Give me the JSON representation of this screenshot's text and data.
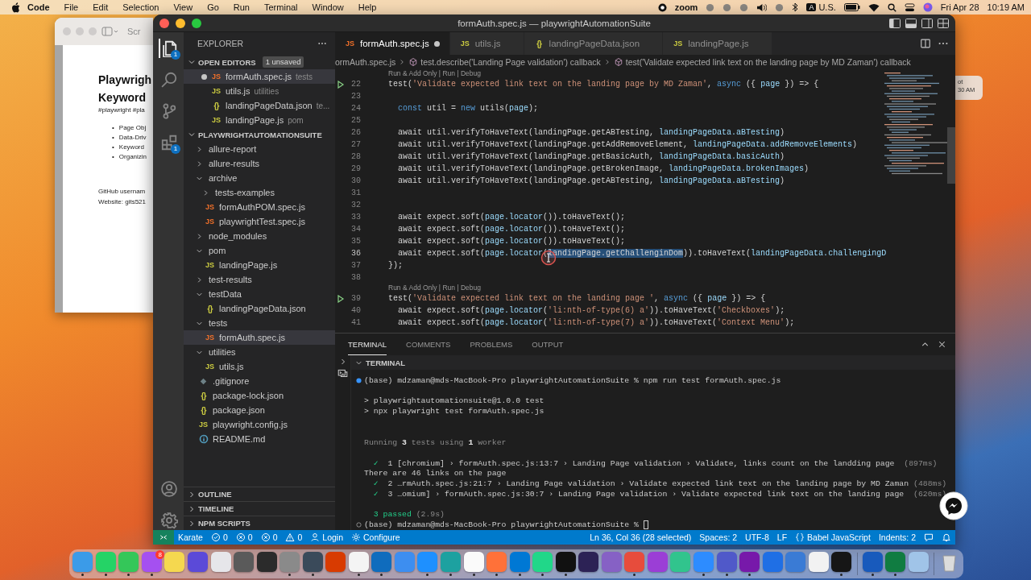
{
  "menubar": {
    "app": "Code",
    "menus": [
      "File",
      "Edit",
      "Selection",
      "View",
      "Go",
      "Run",
      "Terminal",
      "Window",
      "Help"
    ],
    "status_items": [
      {
        "kind": "record"
      },
      {
        "kind": "label",
        "text": "zoom"
      },
      {
        "kind": "dot"
      },
      {
        "kind": "dot"
      },
      {
        "kind": "dot"
      },
      {
        "kind": "speaker"
      },
      {
        "kind": "dot"
      },
      {
        "kind": "bluetooth"
      },
      {
        "kind": "input",
        "badge": "A",
        "text": "U.S."
      },
      {
        "kind": "battery"
      },
      {
        "kind": "wifi"
      },
      {
        "kind": "search"
      },
      {
        "kind": "control"
      },
      {
        "kind": "siri"
      }
    ],
    "date": "Fri Apr 28",
    "time": "10:19 AM"
  },
  "back_window": {
    "toolbar_text": "Scr",
    "heading_lines": [
      "Playwrigh",
      "Keyword"
    ],
    "tags": "#playwright #pla",
    "bullets": [
      {
        "marker": "•",
        "text": "Page Obj"
      },
      {
        "marker": "•",
        "text": "Data-Driv"
      },
      {
        "marker": "•",
        "text": "Keyword"
      },
      {
        "marker": "•",
        "text": "Organizin"
      }
    ],
    "footer_lines": [
      "GitHub usernam",
      "Website: gits521"
    ]
  },
  "notification_fragment": {
    "lines": [
      "ot",
      "30 AM"
    ]
  },
  "window": {
    "title": "formAuth.spec.js — playwrightAutomationSuite"
  },
  "activity_bar": [
    {
      "kind": "files",
      "badge": "1",
      "selected": true
    },
    {
      "kind": "search",
      "selected": false
    },
    {
      "kind": "source-control",
      "selected": false
    },
    {
      "kind": "extensions",
      "badge": "1",
      "selected": false
    },
    {
      "kind": "account",
      "selected": false
    },
    {
      "kind": "settings",
      "selected": false
    }
  ],
  "sidebar": {
    "title": "EXPLORER",
    "open_editors": {
      "title": "OPEN EDITORS",
      "badge": "1 unsaved",
      "expanded": true,
      "items": [
        {
          "kind": "js",
          "icon": "JS",
          "color": "#f0702a",
          "name": "formAuth.spec.js",
          "description": "tests",
          "dirty": true,
          "selected": true
        },
        {
          "kind": "js",
          "icon": "JS",
          "color": "#cbcb41",
          "name": "utils.js",
          "description": "utilities",
          "dirty": false,
          "selected": false
        },
        {
          "kind": "json",
          "icon": "{}",
          "color": "#cbcb41",
          "name": "landingPageData.json",
          "description": "te...",
          "dirty": false,
          "selected": false
        },
        {
          "kind": "js",
          "icon": "JS",
          "color": "#cbcb41",
          "name": "landingPage.js",
          "description": "pom",
          "dirty": false,
          "selected": false
        }
      ]
    },
    "project": {
      "title": "PLAYWRIGHTAUTOMATIONSUITE",
      "expanded": true,
      "tree": [
        {
          "kind": "folder",
          "name": "allure-report",
          "expanded": false,
          "selected": false
        },
        {
          "kind": "folder",
          "name": "allure-results",
          "expanded": false,
          "selected": false
        },
        {
          "kind": "folder",
          "name": "archive",
          "expanded": true,
          "selected": false,
          "children": [
            {
              "kind": "folder",
              "name": "tests-examples",
              "expanded": false,
              "selected": false
            },
            {
              "kind": "js",
              "icon": "JS",
              "color": "#f0702a",
              "name": "formAuthPOM.spec.js",
              "selected": false
            },
            {
              "kind": "js",
              "icon": "JS",
              "color": "#f0702a",
              "name": "playwrightTest.spec.js",
              "selected": false
            }
          ]
        },
        {
          "kind": "folder",
          "name": "node_modules",
          "expanded": false,
          "selected": false
        },
        {
          "kind": "folder",
          "name": "pom",
          "expanded": true,
          "selected": false,
          "children": [
            {
              "kind": "js",
              "icon": "JS",
              "color": "#cbcb41",
              "name": "landingPage.js",
              "selected": false
            }
          ]
        },
        {
          "kind": "folder",
          "name": "test-results",
          "expanded": false,
          "selected": false
        },
        {
          "kind": "folder",
          "name": "testData",
          "expanded": true,
          "selected": false,
          "children": [
            {
              "kind": "json",
              "icon": "{}",
              "color": "#cbcb41",
              "name": "landingPageData.json",
              "selected": false
            }
          ]
        },
        {
          "kind": "folder",
          "name": "tests",
          "expanded": true,
          "selected": false,
          "children": [
            {
              "kind": "js",
              "icon": "JS",
              "color": "#f0702a",
              "name": "formAuth.spec.js",
              "selected": true
            }
          ]
        },
        {
          "kind": "folder",
          "name": "utilities",
          "expanded": true,
          "selected": false,
          "children": [
            {
              "kind": "js",
              "icon": "JS",
              "color": "#cbcb41",
              "name": "utils.js",
              "selected": false
            }
          ]
        },
        {
          "kind": "git",
          "color": "#6d8086",
          "name": ".gitignore",
          "selected": false
        },
        {
          "kind": "json",
          "icon": "{}",
          "color": "#cbcb41",
          "name": "package-lock.json",
          "selected": false
        },
        {
          "kind": "json",
          "icon": "{}",
          "color": "#cbcb41",
          "name": "package.json",
          "selected": false
        },
        {
          "kind": "js",
          "icon": "JS",
          "color": "#cbcb41",
          "name": "playwright.config.js",
          "selected": false
        },
        {
          "kind": "info",
          "color": "#519aba",
          "name": "README.md",
          "selected": false
        }
      ]
    },
    "sections": [
      {
        "title": "OUTLINE",
        "expanded": false
      },
      {
        "title": "TIMELINE",
        "expanded": false
      },
      {
        "title": "NPM SCRIPTS",
        "expanded": false
      }
    ]
  },
  "editor": {
    "tabs": [
      {
        "kind": "js",
        "icon": "JS",
        "color": "#f0702a",
        "label": "formAuth.spec.js",
        "dirty": true,
        "selected": true
      },
      {
        "kind": "js",
        "icon": "JS",
        "color": "#cbcb41",
        "label": "utils.js",
        "dirty": false,
        "selected": false
      },
      {
        "kind": "json",
        "icon": "{}",
        "color": "#cbcb41",
        "label": "landingPageData.json",
        "dirty": false,
        "selected": false
      },
      {
        "kind": "js",
        "icon": "JS",
        "color": "#cbcb41",
        "label": "landingPage.js",
        "dirty": false,
        "selected": false
      }
    ],
    "breadcrumb": [
      {
        "kind": "file",
        "text": "ormAuth.spec.js"
      },
      {
        "kind": "scope",
        "text": "test.describe('Landing Page validation') callback"
      },
      {
        "kind": "scope",
        "text": "test('Validate expected link text on the landing page by MD Zaman') callback"
      }
    ],
    "lines": [
      {
        "kind": "codelens",
        "text": "Run & Add Only | Run | Debug"
      },
      {
        "kind": "test",
        "number": "22",
        "tokens": [
          {
            "text": "test(",
            "kind": "plain"
          },
          {
            "text": "'Validate expected link text on the landing page by MD Zaman'",
            "kind": "string"
          },
          {
            "text": ", ",
            "kind": "plain"
          },
          {
            "text": "async",
            "kind": "keyword"
          },
          {
            "text": " ({ ",
            "kind": "plain"
          },
          {
            "text": "page",
            "kind": "variable"
          },
          {
            "text": " }) => {",
            "kind": "plain"
          }
        ]
      },
      {
        "kind": "code",
        "number": "23"
      },
      {
        "kind": "code",
        "number": "24",
        "tokens": [
          {
            "text": "  const",
            "kind": "keyword"
          },
          {
            "text": " util = ",
            "kind": "plain"
          },
          {
            "text": "new",
            "kind": "keyword"
          },
          {
            "text": " utils(",
            "kind": "plain"
          },
          {
            "text": "page",
            "kind": "variable"
          },
          {
            "text": ");",
            "kind": "plain"
          }
        ]
      },
      {
        "kind": "code",
        "number": "25"
      },
      {
        "kind": "code",
        "number": "26",
        "tokens": [
          {
            "text": "  await util.verifyToHaveText(landingPage.getABTesting, ",
            "kind": "plain"
          },
          {
            "text": "landingPageData.aBTesting",
            "kind": "variable"
          },
          {
            "text": ")",
            "kind": "plain"
          }
        ]
      },
      {
        "kind": "code",
        "number": "27",
        "tokens": [
          {
            "text": "  await util.verifyToHaveText(landingPage.getAddRemoveElement, ",
            "kind": "plain"
          },
          {
            "text": "landingPageData.addRemoveElements",
            "kind": "variable"
          },
          {
            "text": ")",
            "kind": "plain"
          }
        ]
      },
      {
        "kind": "code",
        "number": "28",
        "tokens": [
          {
            "text": "  await util.verifyToHaveText(landingPage.getBasicAuth, ",
            "kind": "plain"
          },
          {
            "text": "landingPageData.basicAuth",
            "kind": "variable"
          },
          {
            "text": ")",
            "kind": "plain"
          }
        ]
      },
      {
        "kind": "code",
        "number": "29",
        "tokens": [
          {
            "text": "  await util.verifyToHaveText(landingPage.getBrokenImage, ",
            "kind": "plain"
          },
          {
            "text": "landingPageData.brokenImages",
            "kind": "variable"
          },
          {
            "text": ")",
            "kind": "plain"
          }
        ]
      },
      {
        "kind": "code",
        "number": "30",
        "tokens": [
          {
            "text": "  await util.verifyToHaveText(landingPage.getABTesting, ",
            "kind": "plain"
          },
          {
            "text": "landingPageData.aBTesting",
            "kind": "variable"
          },
          {
            "text": ")",
            "kind": "plain"
          }
        ]
      },
      {
        "kind": "code",
        "number": "31"
      },
      {
        "kind": "code",
        "number": "32"
      },
      {
        "kind": "code",
        "number": "33",
        "tokens": [
          {
            "text": "  await expect.soft(",
            "kind": "plain"
          },
          {
            "text": "page.locator",
            "kind": "variable"
          },
          {
            "text": "()).toHaveText();",
            "kind": "plain"
          }
        ]
      },
      {
        "kind": "code",
        "number": "34",
        "tokens": [
          {
            "text": "  await expect.soft(",
            "kind": "plain"
          },
          {
            "text": "page.locator",
            "kind": "variable"
          },
          {
            "text": "()).toHaveText();",
            "kind": "plain"
          }
        ]
      },
      {
        "kind": "code",
        "number": "35",
        "tokens": [
          {
            "text": "  await expect.soft(",
            "kind": "plain"
          },
          {
            "text": "page.locator",
            "kind": "variable"
          },
          {
            "text": "()).toHaveText();",
            "kind": "plain"
          }
        ]
      },
      {
        "kind": "code",
        "number": "36",
        "tokens": [
          {
            "text": "  await expect.soft(",
            "kind": "plain"
          },
          {
            "text": "page.locator",
            "kind": "variable"
          },
          {
            "text": "(",
            "kind": "plain"
          },
          {
            "text": "landingPage.getChallenginDom",
            "kind": "selection"
          },
          {
            "text": ")).toHaveText(",
            "kind": "plain"
          },
          {
            "text": "landingPageData.challengingD",
            "kind": "variable"
          }
        ]
      },
      {
        "kind": "code",
        "number": "37",
        "tokens": [
          {
            "text": "});",
            "kind": "plain"
          }
        ]
      },
      {
        "kind": "code",
        "number": "38"
      },
      {
        "kind": "codelens",
        "text": "Run & Add Only | Run | Debug"
      },
      {
        "kind": "test",
        "number": "39",
        "tokens": [
          {
            "text": "test(",
            "kind": "plain"
          },
          {
            "text": "'Validate expected link text on the landing page '",
            "kind": "string"
          },
          {
            "text": ", ",
            "kind": "plain"
          },
          {
            "text": "async",
            "kind": "keyword"
          },
          {
            "text": " ({ ",
            "kind": "plain"
          },
          {
            "text": "page",
            "kind": "variable"
          },
          {
            "text": " }) => {",
            "kind": "plain"
          }
        ]
      },
      {
        "kind": "code",
        "number": "40",
        "tokens": [
          {
            "text": "  await expect.soft(",
            "kind": "plain"
          },
          {
            "text": "page.locator",
            "kind": "variable"
          },
          {
            "text": "(",
            "kind": "plain"
          },
          {
            "text": "'li:nth-of-type(6) a'",
            "kind": "string"
          },
          {
            "text": ")).toHaveText(",
            "kind": "plain"
          },
          {
            "text": "'Checkboxes'",
            "kind": "string"
          },
          {
            "text": ");",
            "kind": "plain"
          }
        ]
      },
      {
        "kind": "code",
        "number": "41",
        "tokens": [
          {
            "text": "  await expect.soft(",
            "kind": "plain"
          },
          {
            "text": "page.locator",
            "kind": "variable"
          },
          {
            "text": "(",
            "kind": "plain"
          },
          {
            "text": "'li:nth-of-type(7) a'",
            "kind": "string"
          },
          {
            "text": ")).toHaveText(",
            "kind": "plain"
          },
          {
            "text": "'Context Menu'",
            "kind": "string"
          },
          {
            "text": ");",
            "kind": "plain"
          }
        ]
      }
    ]
  },
  "panel": {
    "tabs": [
      {
        "label": "TERMINAL",
        "selected": true
      },
      {
        "label": "COMMENTS",
        "selected": false
      },
      {
        "label": "PROBLEMS",
        "selected": false
      },
      {
        "label": "OUTPUT",
        "selected": false
      }
    ],
    "section_title": "TERMINAL",
    "lines": [
      {
        "kind": "command",
        "segments": [
          {
            "text": "(base) mdzaman@mds-MacBook-Pro playwrightAutomationSuite % npm run test formAuth.spec.js",
            "kind": "plain"
          }
        ]
      },
      {
        "kind": "blank"
      },
      {
        "kind": "output",
        "segments": [
          {
            "text": "> playwrightautomationsuite@1.0.0 test",
            "kind": "plain"
          }
        ]
      },
      {
        "kind": "output",
        "segments": [
          {
            "text": "> npx playwright test formAuth.spec.js",
            "kind": "plain"
          }
        ]
      },
      {
        "kind": "blank"
      },
      {
        "kind": "blank"
      },
      {
        "kind": "output",
        "segments": [
          {
            "text": "Running ",
            "kind": "dim"
          },
          {
            "text": "3",
            "kind": "bold"
          },
          {
            "text": " tests using ",
            "kind": "dim"
          },
          {
            "text": "1",
            "kind": "bold"
          },
          {
            "text": " worker",
            "kind": "dim"
          }
        ]
      },
      {
        "kind": "blank"
      },
      {
        "kind": "output",
        "segments": [
          {
            "text": "  ✓",
            "kind": "green"
          },
          {
            "text": "  1 [chromium] › formAuth.spec.js:13:7 › Landing Page validation › Validate, links count on the landding page  ",
            "kind": "plain"
          },
          {
            "text": "(897ms)",
            "kind": "dim"
          }
        ]
      },
      {
        "kind": "output",
        "segments": [
          {
            "text": "There are 46 links on the page",
            "kind": "plain"
          }
        ]
      },
      {
        "kind": "output",
        "segments": [
          {
            "text": "  ✓",
            "kind": "green"
          },
          {
            "text": "  2 …rmAuth.spec.js:21:7 › Landing Page validation › Validate expected link text on the landing page by MD Zaman ",
            "kind": "plain"
          },
          {
            "text": "(488ms)",
            "kind": "dim"
          }
        ]
      },
      {
        "kind": "output",
        "segments": [
          {
            "text": "  ✓",
            "kind": "green"
          },
          {
            "text": "  3 …omium] › formAuth.spec.js:30:7 › Landing Page validation › Validate expected link text on the landing page  ",
            "kind": "plain"
          },
          {
            "text": "(620ms)",
            "kind": "dim"
          }
        ]
      },
      {
        "kind": "blank"
      },
      {
        "kind": "output",
        "segments": [
          {
            "text": "  3 passed ",
            "kind": "green"
          },
          {
            "text": "(2.9s)",
            "kind": "dim"
          }
        ]
      },
      {
        "kind": "prompt",
        "segments": [
          {
            "text": "(base) mdzaman@mds-MacBook-Pro playwrightAutomationSuite %",
            "kind": "plain"
          }
        ]
      }
    ]
  },
  "status_bar": {
    "left": [
      {
        "kind": "remote"
      },
      {
        "kind": "text",
        "text": "Karate"
      },
      {
        "kind": "check-circle",
        "text": "0"
      },
      {
        "kind": "x-circle",
        "text": "0"
      },
      {
        "kind": "x-circle",
        "text": "0"
      },
      {
        "kind": "warning",
        "text": "0"
      },
      {
        "kind": "person",
        "text": "Login"
      },
      {
        "kind": "gear",
        "text": "Configure"
      }
    ],
    "right": [
      {
        "kind": "text",
        "text": "Ln 36, Col 36 (28 selected)"
      },
      {
        "kind": "text",
        "text": "Spaces: 2"
      },
      {
        "kind": "text",
        "text": "UTF-8"
      },
      {
        "kind": "text",
        "text": "LF"
      },
      {
        "kind": "braces",
        "text": "Babel JavaScript"
      },
      {
        "kind": "text",
        "text": "Indents: 2"
      },
      {
        "kind": "feedback"
      },
      {
        "kind": "bell"
      }
    ]
  },
  "dock": [
    {
      "kind": "app",
      "color": "#3b9be8",
      "running": true
    },
    {
      "kind": "app",
      "color": "#25d366",
      "running": true
    },
    {
      "kind": "app",
      "color": "#34c759",
      "running": true
    },
    {
      "kind": "app",
      "color": "#a550f0",
      "running": true,
      "badge": "8"
    },
    {
      "kind": "app",
      "color": "#f5d84f",
      "running": false
    },
    {
      "kind": "app",
      "color": "#5b4ad8",
      "running": false
    },
    {
      "kind": "app",
      "color": "#e6e6ea",
      "running": false
    },
    {
      "kind": "app",
      "color": "#5a5a5a",
      "running": false
    },
    {
      "kind": "app",
      "color": "#2b2b2b",
      "running": false
    },
    {
      "kind": "app",
      "color": "#8a8a8a",
      "running": true
    },
    {
      "kind": "app",
      "color": "#3a4a5a",
      "running": true
    },
    {
      "kind": "app",
      "color": "#d83b01",
      "running": false
    },
    {
      "kind": "app",
      "color": "#f4f4f4",
      "running": true
    },
    {
      "kind": "app",
      "color": "#0f6cbd",
      "running": true
    },
    {
      "kind": "app",
      "color": "#3d8ef0",
      "running": false
    },
    {
      "kind": "app",
      "color": "#1e90ff",
      "running": true
    },
    {
      "kind": "app",
      "color": "#1da1a0",
      "running": true
    },
    {
      "kind": "app",
      "color": "#fafafa",
      "running": true
    },
    {
      "kind": "app",
      "color": "#ff7139",
      "running": true
    },
    {
      "kind": "app",
      "color": "#0078d4",
      "running": true
    },
    {
      "kind": "app",
      "color": "#21d789",
      "running": true
    },
    {
      "kind": "app",
      "color": "#111111",
      "running": true
    },
    {
      "kind": "app",
      "color": "#2c2255",
      "running": false
    },
    {
      "kind": "app",
      "color": "#8661c5",
      "running": false
    },
    {
      "kind": "app",
      "color": "#e74c3c",
      "running": true
    },
    {
      "kind": "app",
      "color": "#9b3ed6",
      "running": false
    },
    {
      "kind": "app",
      "color": "#31c48d",
      "running": false
    },
    {
      "kind": "app",
      "color": "#2d8cff",
      "running": true
    },
    {
      "kind": "app",
      "color": "#5059c9",
      "running": true
    },
    {
      "kind": "app",
      "color": "#7719aa",
      "running": true
    },
    {
      "kind": "app",
      "color": "#1f6fe5",
      "running": false
    },
    {
      "kind": "app",
      "color": "#3a7bd5",
      "running": false
    },
    {
      "kind": "app",
      "color": "#f2f2f2",
      "running": false
    },
    {
      "kind": "app",
      "color": "#161616",
      "running": true
    },
    {
      "kind": "separator"
    },
    {
      "kind": "app",
      "color": "#185abc",
      "running": true
    },
    {
      "kind": "app",
      "color": "#107c41",
      "running": true
    },
    {
      "kind": "app",
      "color": "#a0c4e8",
      "running": false
    },
    {
      "kind": "separator"
    },
    {
      "kind": "trash",
      "color": "#dcdcdc",
      "running": false
    }
  ]
}
